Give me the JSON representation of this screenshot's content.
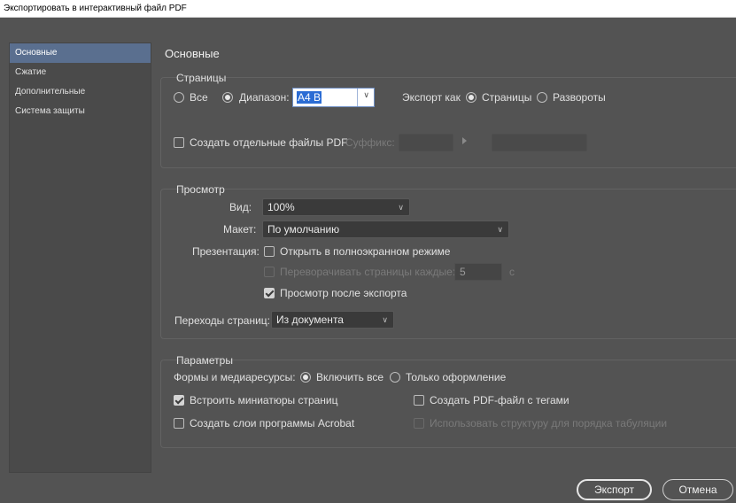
{
  "window": {
    "title": "Экспортировать в интерактивный файл PDF"
  },
  "sidebar": {
    "items": [
      {
        "label": "Основные",
        "active": true
      },
      {
        "label": "Сжатие"
      },
      {
        "label": "Дополнительные"
      },
      {
        "label": "Система защиты"
      }
    ]
  },
  "page": {
    "heading": "Основные"
  },
  "pages_group": {
    "title": "Страницы",
    "all_label": "Все",
    "range_label": "Диапазон:",
    "range_value": "A4 B",
    "export_as_label": "Экспорт как",
    "pages_option": "Страницы",
    "spreads_option": "Развороты",
    "separate_files_label": "Создать отдельные файлы PDF",
    "suffix_label": "Суффикс:"
  },
  "view_group": {
    "title": "Просмотр",
    "view_label": "Вид:",
    "view_value": "100%",
    "layout_label": "Макет:",
    "layout_value": "По умолчанию",
    "presentation_label": "Презентация:",
    "fullscreen_label": "Открыть в полноэкранном режиме",
    "flip_label": "Переворачивать страницы каждые:",
    "flip_value": "5",
    "flip_unit": "с",
    "view_after_label": "Просмотр после экспорта",
    "transitions_label": "Переходы страниц:",
    "transitions_value": "Из документа"
  },
  "options_group": {
    "title": "Параметры",
    "forms_label": "Формы и медиаресурсы:",
    "include_all_label": "Включить все",
    "appearance_only_label": "Только оформление",
    "embed_thumbs_label": "Встроить миниатюры страниц",
    "tagged_pdf_label": "Создать PDF-файл с тегами",
    "acrobat_layers_label": "Создать слои программы Acrobat",
    "tab_order_label": "Использовать структуру для порядка табуляции"
  },
  "buttons": {
    "export": "Экспорт",
    "cancel": "Отмена"
  },
  "colors": {
    "background": "#535353",
    "sidebar_active": "#5a6f8f",
    "field_bg": "#3a3a3a",
    "selection": "#2b6cd4"
  },
  "icons": {
    "dropdown": "chevron-down-icon",
    "suffix": "triangle-right-icon",
    "checkbox": "check-icon"
  }
}
